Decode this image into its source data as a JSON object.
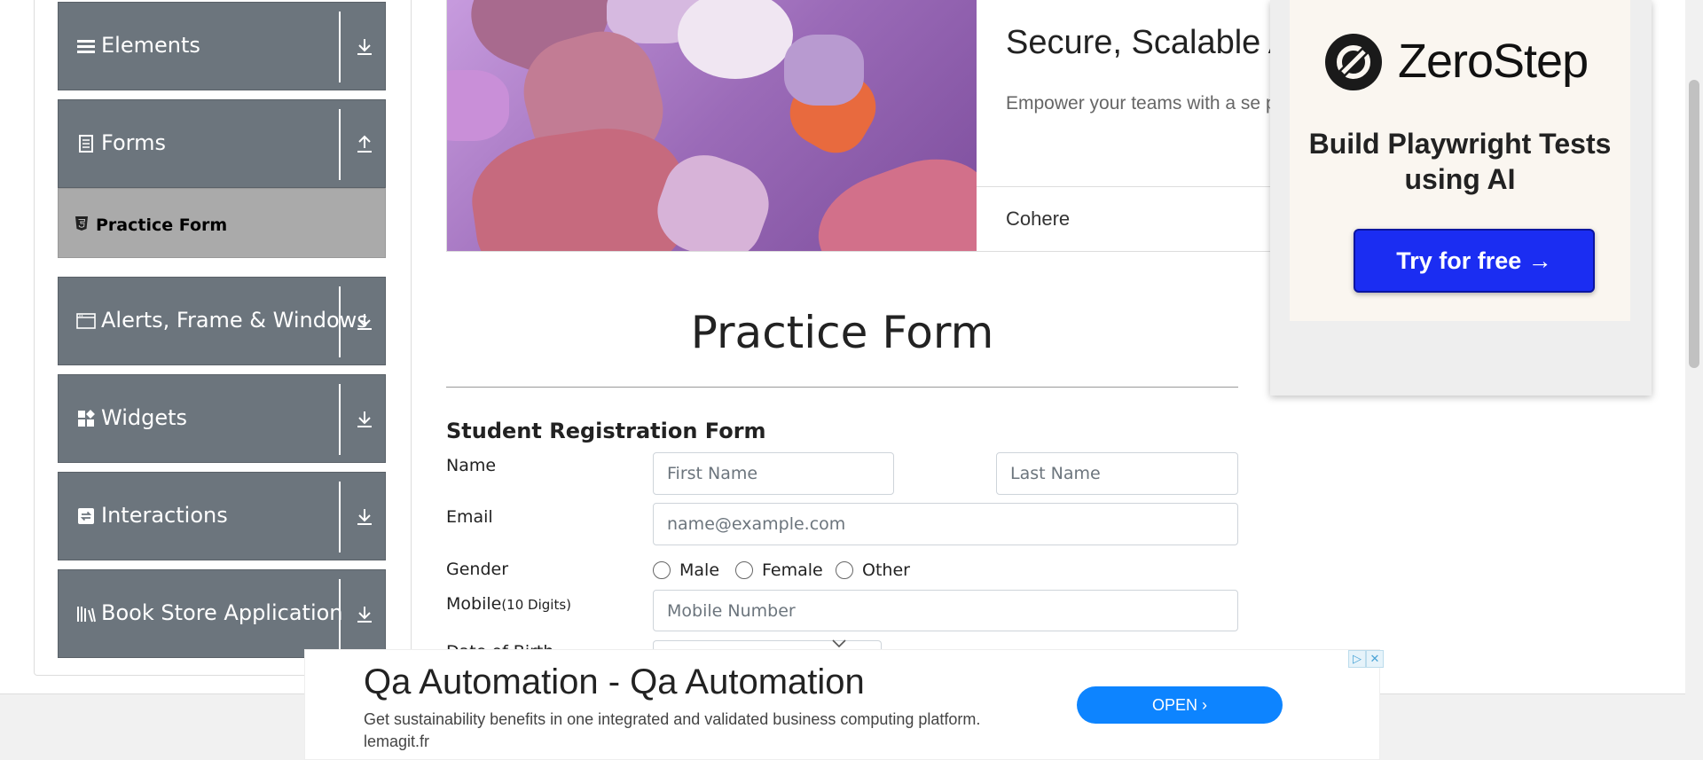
{
  "sidebar": {
    "groups": [
      {
        "label": "Elements",
        "icon": "list-icon",
        "arrow": "download-arrow-icon"
      },
      {
        "label": "Forms",
        "icon": "document-icon",
        "arrow": "upload-arrow-icon"
      },
      {
        "label": "Alerts, Frame & Windows",
        "icon": "window-icon",
        "arrow": "download-arrow-icon"
      },
      {
        "label": "Widgets",
        "icon": "widgets-icon",
        "arrow": "download-arrow-icon"
      },
      {
        "label": "Interactions",
        "icon": "interactions-icon",
        "arrow": "download-arrow-icon"
      },
      {
        "label": "Book Store Application",
        "icon": "books-icon",
        "arrow": "download-arrow-icon"
      }
    ],
    "active_item": {
      "label": "Practice Form",
      "icon": "html5-icon"
    }
  },
  "content_ad": {
    "headline": "Secure, Scalable A",
    "description": "Empower your teams with a se platform — from chat to searc",
    "brand": "Cohere"
  },
  "right_ad": {
    "logo_text": "ZeroStep",
    "tagline": "Build Playwright Tests using AI",
    "cta": "Try for free →"
  },
  "form": {
    "page_title": "Practice Form",
    "heading": "Student Registration Form",
    "name_label": "Name",
    "first_name_placeholder": "First Name",
    "last_name_placeholder": "Last Name",
    "email_label": "Email",
    "email_placeholder": "name@example.com",
    "gender_label": "Gender",
    "gender_options": [
      "Male",
      "Female",
      "Other"
    ],
    "mobile_label": "Mobile",
    "mobile_hint": "(10 Digits)",
    "mobile_placeholder": "Mobile Number",
    "dob_label": "Date of Birth"
  },
  "bottom_ad": {
    "headline": "Qa Automation - Qa Automation",
    "description": "Get sustainability benefits in one integrated and validated business computing platform. lemagit.fr",
    "cta": "OPEN"
  },
  "colors": {
    "sidebar_bg": "#6c757d",
    "active_item_bg": "#aaaaaa",
    "cta_blue": "#1b2df2",
    "open_blue": "#0d84ff"
  }
}
